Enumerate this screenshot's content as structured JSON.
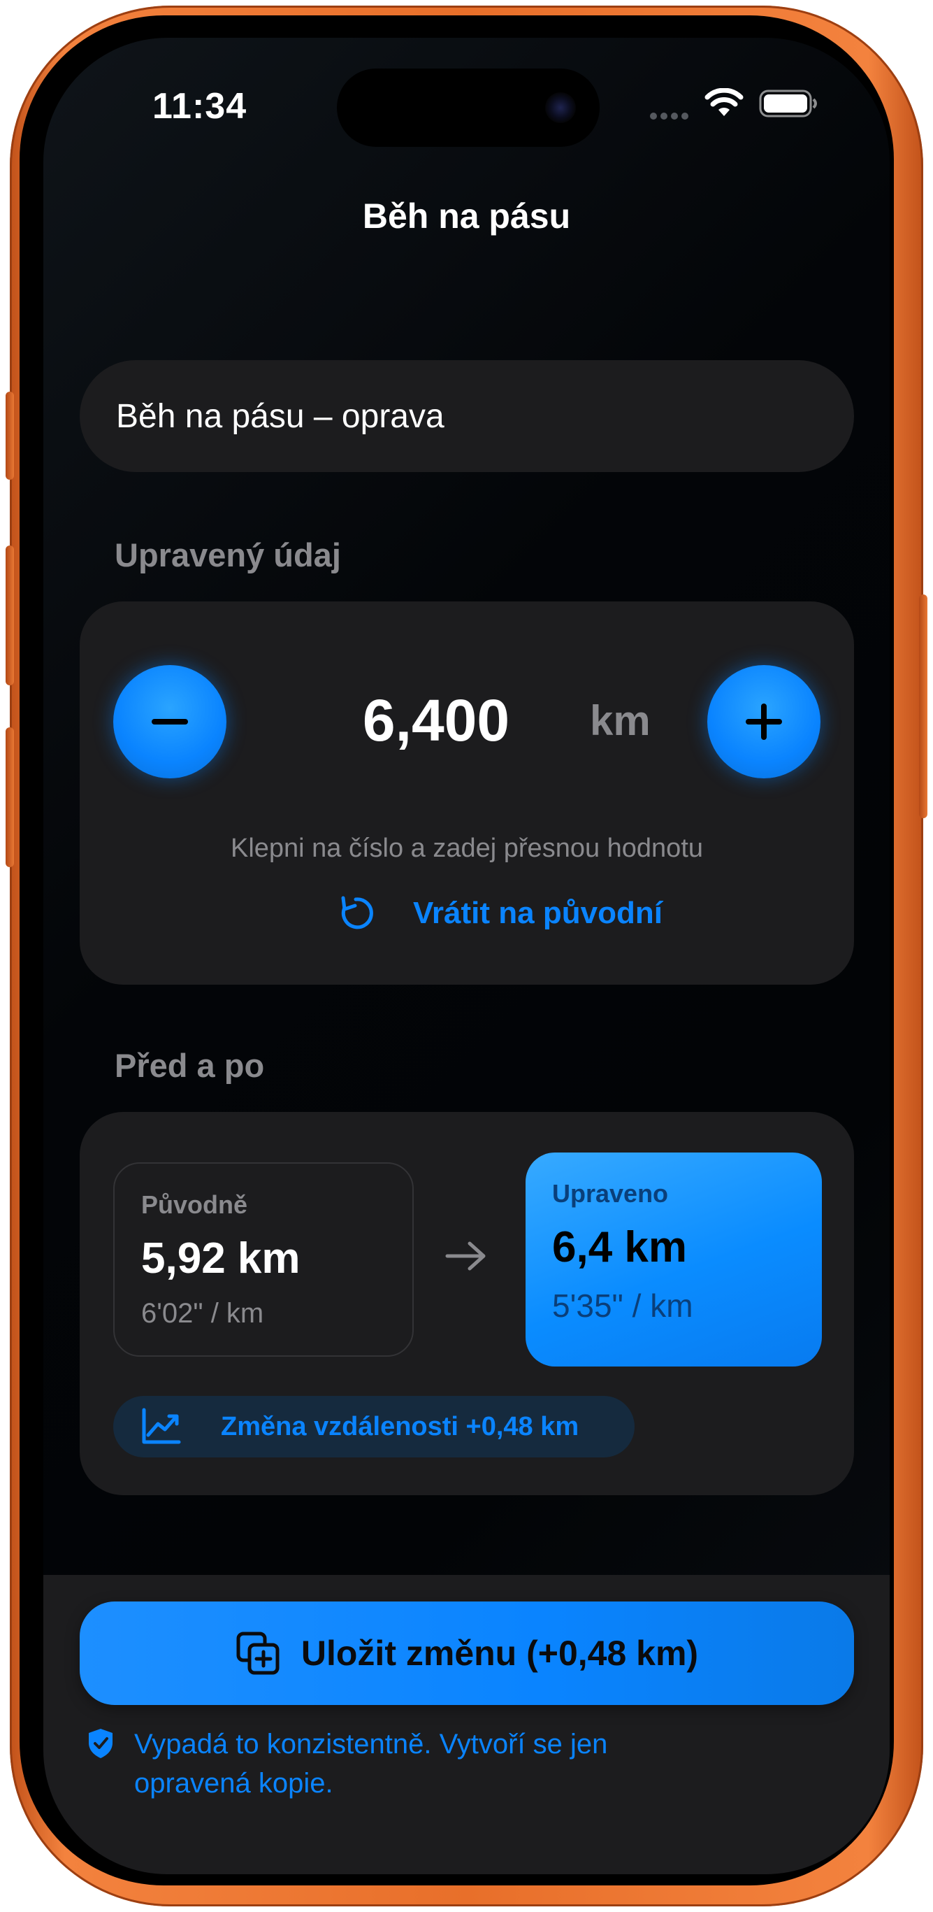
{
  "status_bar": {
    "time": "11:34",
    "icons": [
      "cellular-dots-icon",
      "wifi-icon",
      "battery-icon"
    ]
  },
  "nav": {
    "title": "Běh na pásu"
  },
  "name_field": {
    "value": "Běh na pásu – oprava"
  },
  "edit_section": {
    "label": "Upravený údaj",
    "value": "6,400",
    "unit": "km",
    "decrement_icon": "minus-icon",
    "increment_icon": "plus-icon",
    "hint": "Klepni na číslo a zadej přesnou hodnotu",
    "reset_label": "Vrátit na původní",
    "reset_icon": "undo-icon"
  },
  "compare_section": {
    "label": "Před a po",
    "before": {
      "caption": "Původně",
      "value": "5,92 km",
      "pace": "6'02\" / km"
    },
    "after": {
      "caption": "Upraveno",
      "value": "6,4 km",
      "pace": "5'35\" / km"
    },
    "arrow_icon": "arrow-right-icon",
    "change_icon": "trend-up-icon",
    "change_label": "Změna vzdálenosti +0,48 km"
  },
  "footer": {
    "save_label": "Uložit změnu (+0,48 km)",
    "save_icon": "duplicate-plus-icon",
    "note_icon": "shield-check-icon",
    "note": "Vypadá to konzistentně. Vytvoří se jen opravená kopie."
  },
  "colors": {
    "accent": "#0a84ff",
    "card": "#1c1c1e",
    "frame": "#e86f2a",
    "secondary_text": "#8a8a8e"
  }
}
